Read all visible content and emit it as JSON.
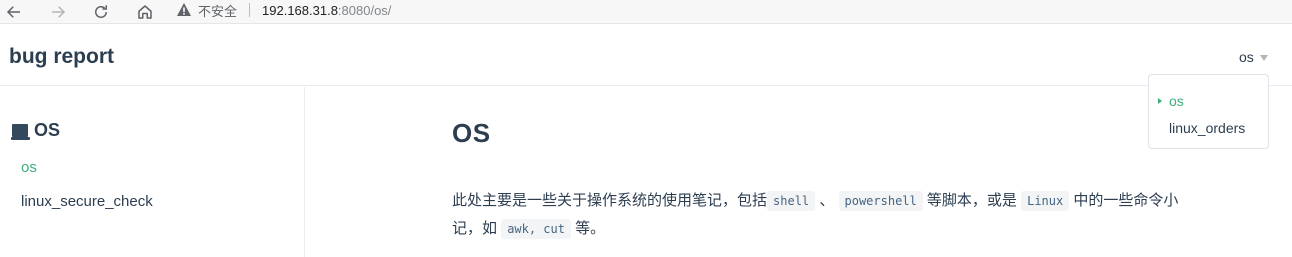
{
  "browser": {
    "insecure_label": "不安全",
    "url_host": "192.168.31.8",
    "url_rest": ":8080/os/"
  },
  "navbar": {
    "site_name": "bug report",
    "dropdown_label": "os",
    "dropdown_items": [
      "os",
      "linux_orders"
    ]
  },
  "sidebar": {
    "heading": "OS",
    "links": [
      "os",
      "linux_secure_check"
    ]
  },
  "content": {
    "title": "OS",
    "p1_a": "此处主要是一些关于操作系统的使用笔记，包括",
    "code_shell": "shell",
    "p1_b": "、",
    "code_powershell": "powershell",
    "p1_c": "等脚本，或是",
    "code_linux": "Linux",
    "p1_d": "中的一些命令小记，如",
    "code_awk": "awk, cut",
    "p1_e": "等。"
  }
}
